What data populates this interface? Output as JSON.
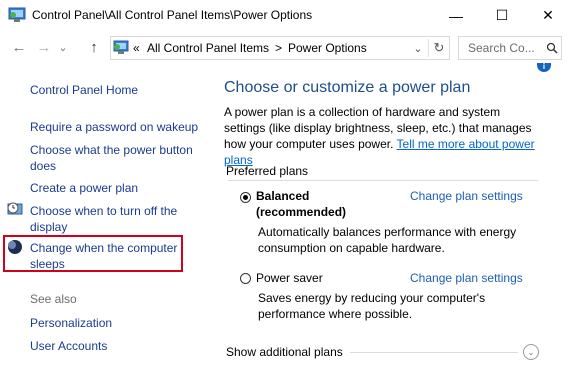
{
  "window": {
    "title": "Control Panel\\All Control Panel Items\\Power Options",
    "minimize": "—",
    "maximize": "☐",
    "close": "✕"
  },
  "nav": {
    "back": "←",
    "forward": "→",
    "recent": "⌄",
    "up": "↑",
    "address_prefix": "«",
    "crumb1": "All Control Panel Items",
    "crumb_sep": ">",
    "crumb2": "Power Options",
    "search_placeholder": "Search Co...",
    "refresh": "↻",
    "dropdown": "⌄"
  },
  "sidebar": {
    "home": "Control Panel Home",
    "items": [
      "Require a password on wakeup",
      "Choose what the power button\ndoes",
      "Create a power plan",
      "Choose when to turn off the\ndisplay",
      "Change when the computer\nsleeps"
    ],
    "see_also": "See also",
    "see_also_items": [
      "Personalization",
      "User Accounts"
    ]
  },
  "main": {
    "heading": "Choose or customize a power plan",
    "intro": "A power plan is a collection of hardware and system settings (like display brightness, sleep, etc.) that manages how your computer uses power.",
    "intro_link": "Tell me more about power plans",
    "preferred": "Preferred plans",
    "plans": [
      {
        "name": "Balanced",
        "sub": "(recommended)",
        "selected": true,
        "link": "Change plan settings",
        "desc": "Automatically balances performance with energy consumption on capable hardware."
      },
      {
        "name": "Power saver",
        "sub": "",
        "selected": false,
        "link": "Change plan settings",
        "desc": "Saves energy by reducing your computer's performance where possible."
      }
    ],
    "show_more": "Show additional plans"
  },
  "colors": {
    "link": "#1a3b8f",
    "heading": "#1e4e8c",
    "highlight": "#d0021b",
    "accent": "#0066cc"
  }
}
